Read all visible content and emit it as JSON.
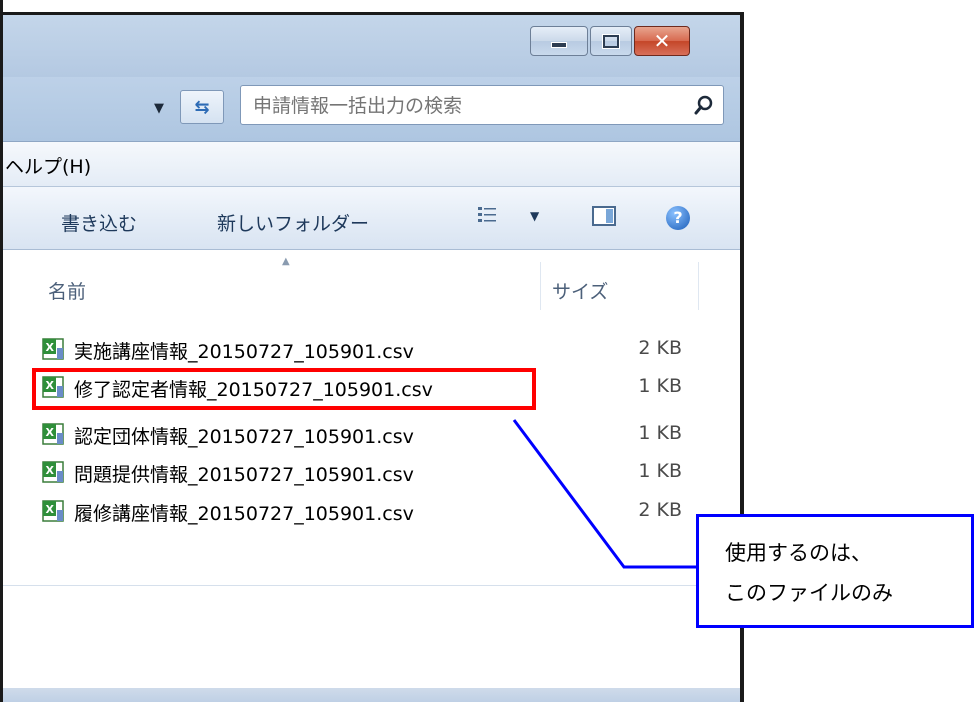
{
  "search": {
    "placeholder": "申請情報一括出力の検索"
  },
  "menu": {
    "help_label": "ヘルプ(H)"
  },
  "toolbar": {
    "burn_label": "書き込む",
    "new_folder_label": "新しいフォルダー"
  },
  "columns": {
    "name": "名前",
    "size": "サイズ"
  },
  "files": [
    {
      "name": "実施講座情報_20150727_105901.csv",
      "size": "2 KB"
    },
    {
      "name": "修了認定者情報_20150727_105901.csv",
      "size": "1 KB"
    },
    {
      "name": "認定団体情報_20150727_105901.csv",
      "size": "1 KB"
    },
    {
      "name": "問題提供情報_20150727_105901.csv",
      "size": "1 KB"
    },
    {
      "name": "履修講座情報_20150727_105901.csv",
      "size": "2 KB"
    }
  ],
  "callout": {
    "line1": "使用するのは、",
    "line2": "このファイルのみ"
  },
  "colors": {
    "highlight": "#ff0000",
    "callout_border": "#0000ff"
  },
  "icons": {
    "file": "excel-csv-icon",
    "search": "search-icon",
    "help": "help-icon"
  }
}
